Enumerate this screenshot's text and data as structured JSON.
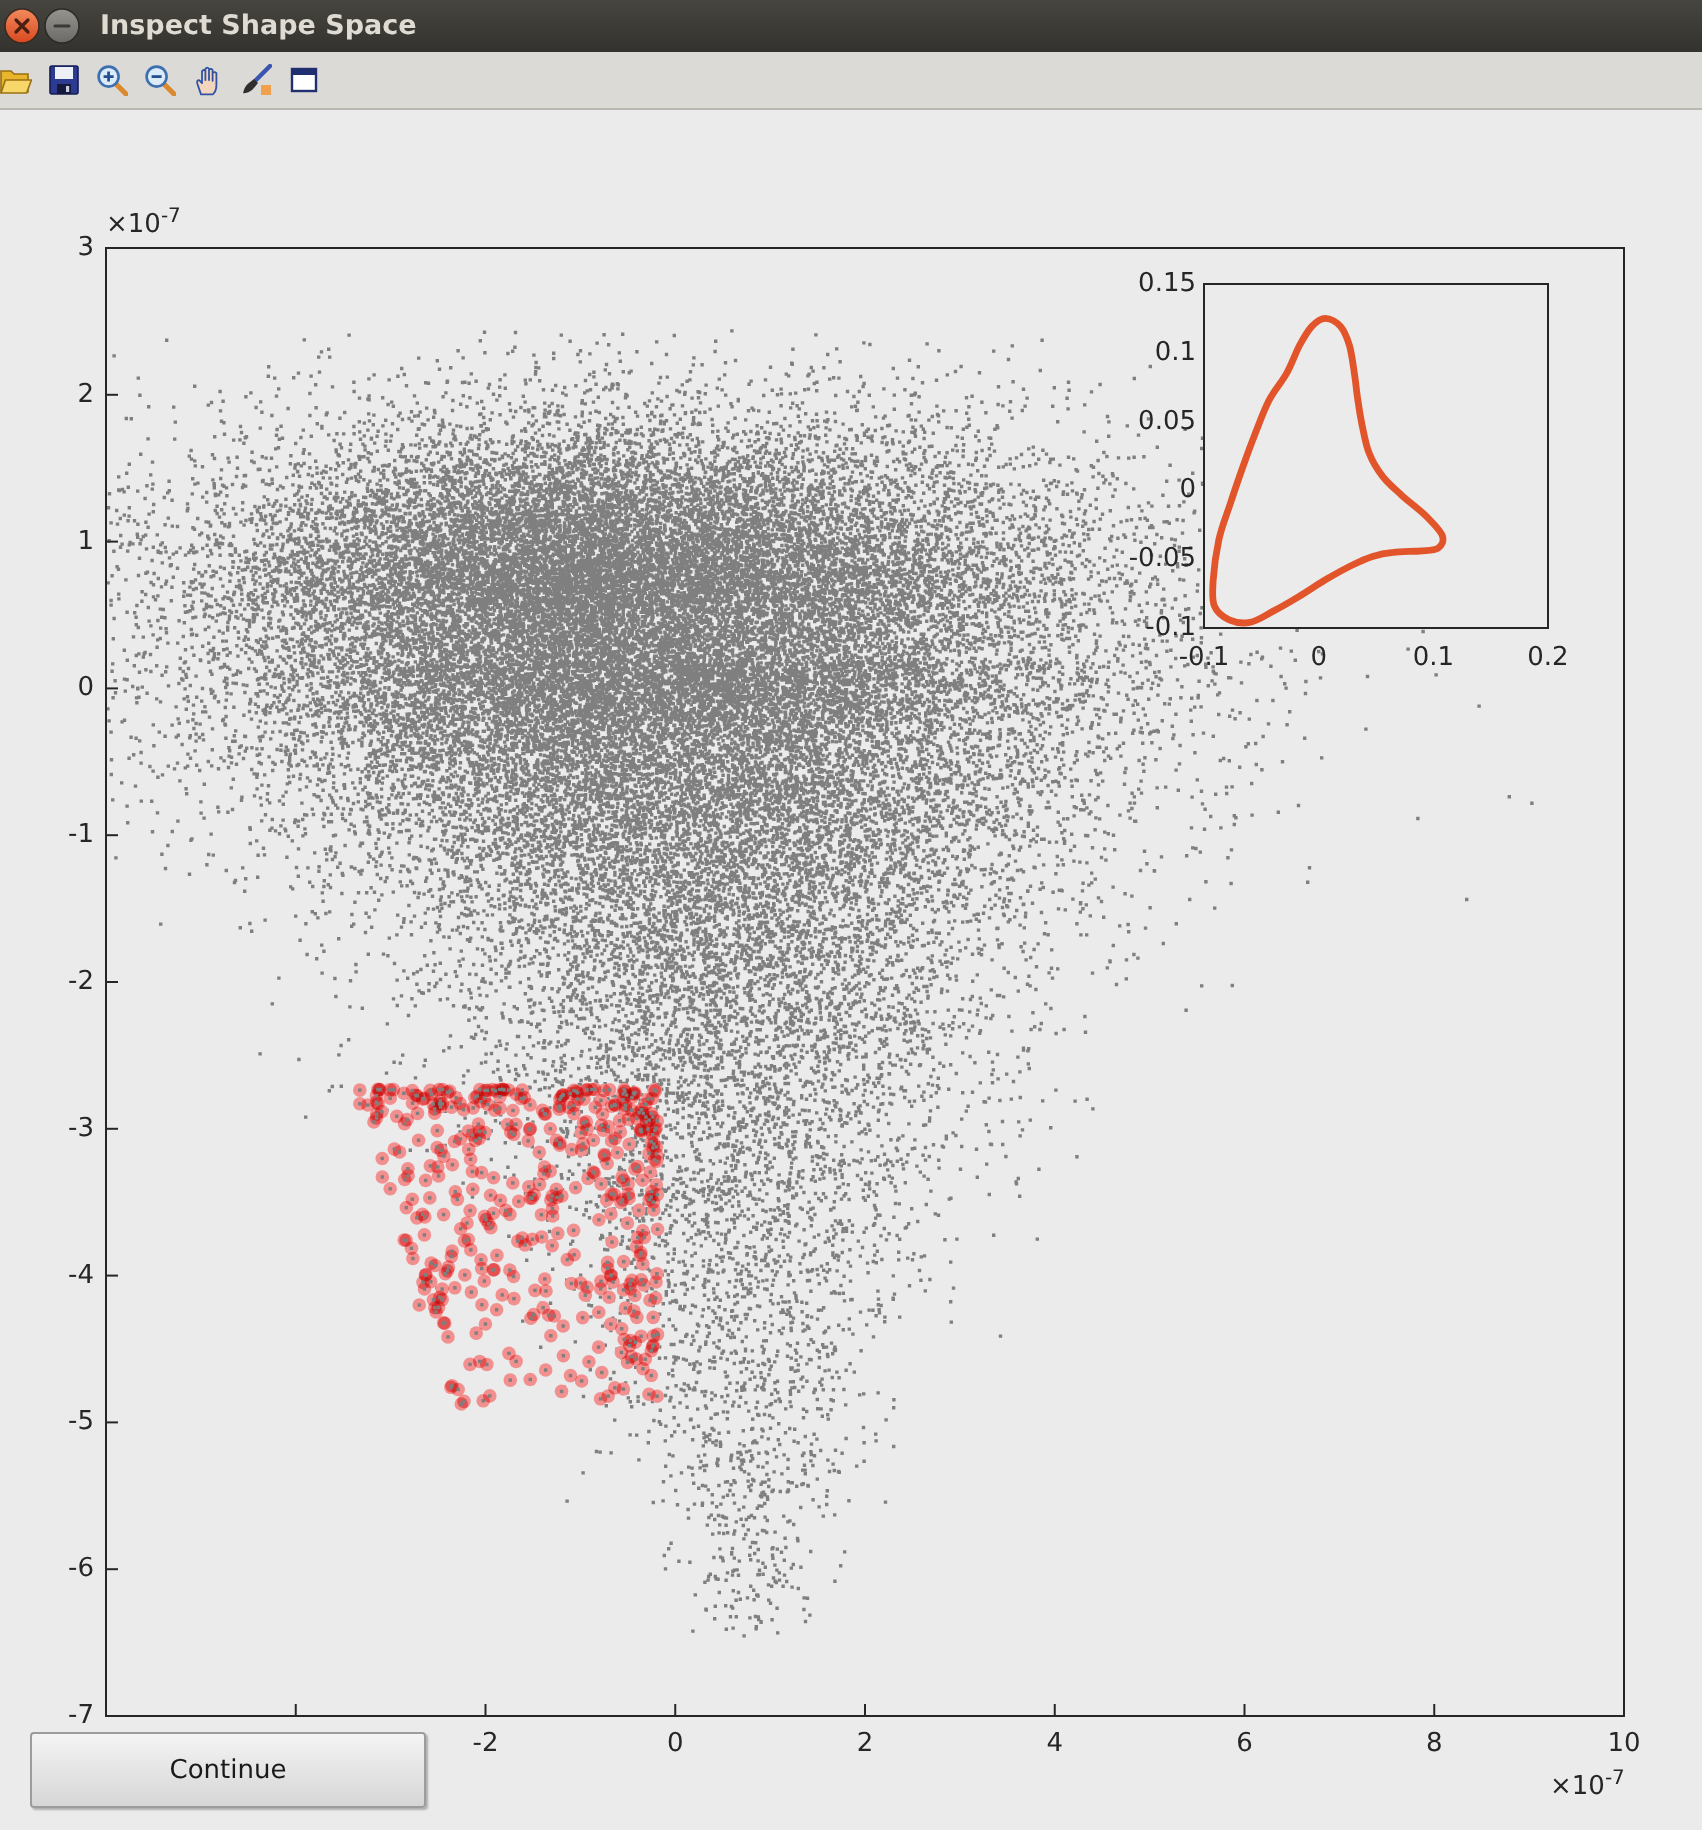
{
  "window": {
    "title": "Inspect Shape Space"
  },
  "axes": {
    "y_multiplier": {
      "base": "×10",
      "exponent": "-7"
    },
    "y_tick_labels": [
      "3",
      "2",
      "1",
      "0",
      "-1",
      "-2",
      "-3",
      "-4",
      "-5",
      "-6",
      "-7"
    ],
    "x_tick_labels": [
      "-2",
      "0",
      "2",
      "4",
      "6",
      "8",
      "10"
    ],
    "x_multiplier": {
      "base": "×10",
      "exponent": "-7"
    },
    "point_sets": [
      {
        "kind": "cloud",
        "color": "#7f7f7f"
      },
      {
        "kind": "selection",
        "color": "#f29090"
      }
    ]
  },
  "inset": {
    "y_tick_labels": [
      "0.15",
      "0.1",
      "0.05",
      "0",
      "-0.05",
      "-0.1"
    ],
    "x_tick_labels": [
      "-0.1",
      "0",
      "0.1",
      "0.2"
    ]
  },
  "continue_button": {
    "label": "Continue"
  }
}
